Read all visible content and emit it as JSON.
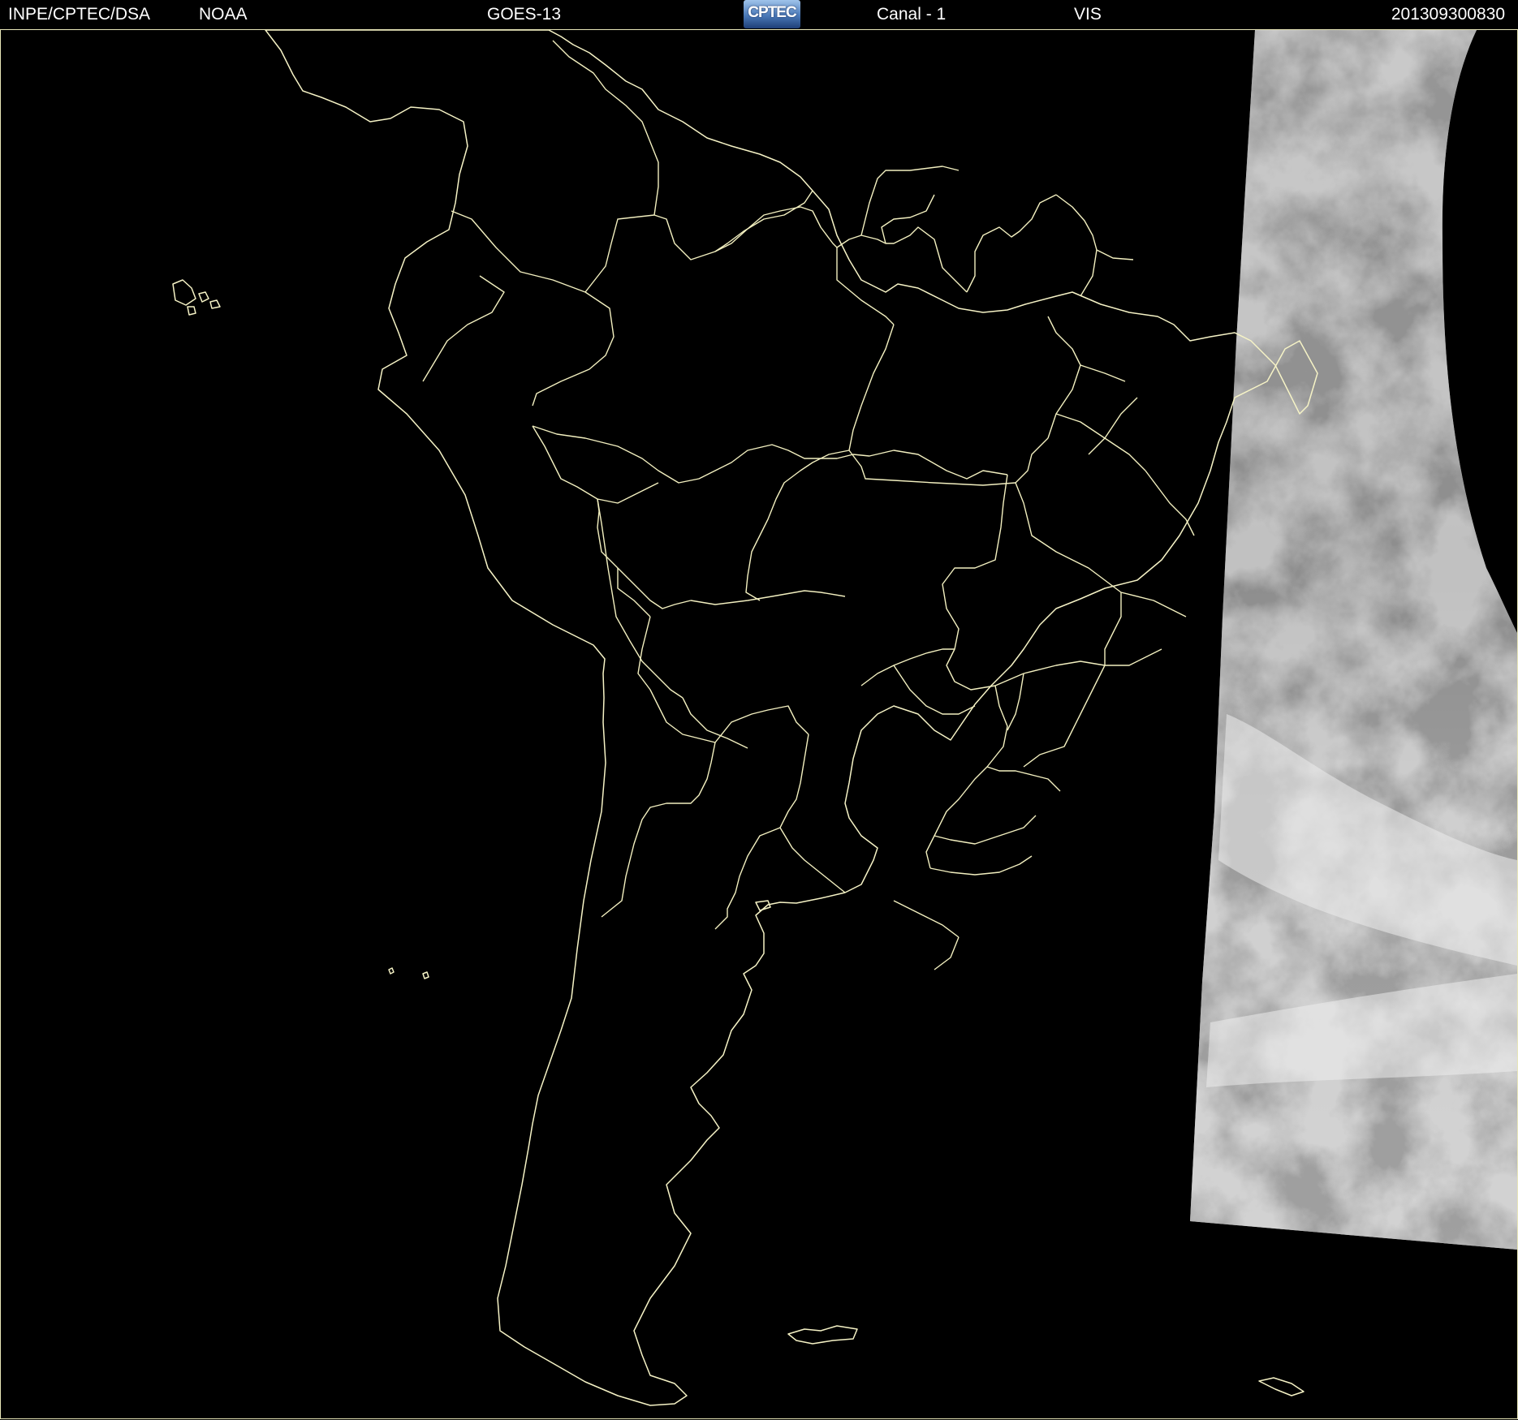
{
  "header": {
    "agency": "INPE/CPTEC/DSA",
    "source": "NOAA",
    "satellite": "GOES-13",
    "logo_text": "CPTEC",
    "channel": "Canal - 1",
    "band": "VIS",
    "timestamp": "201309300830"
  },
  "colors": {
    "background": "#000000",
    "map_lines": "#f3f0c0",
    "header_text": "#ffffff",
    "logo_blue": "#4a79b8"
  },
  "icons": {
    "logo": "cptec-logo"
  }
}
